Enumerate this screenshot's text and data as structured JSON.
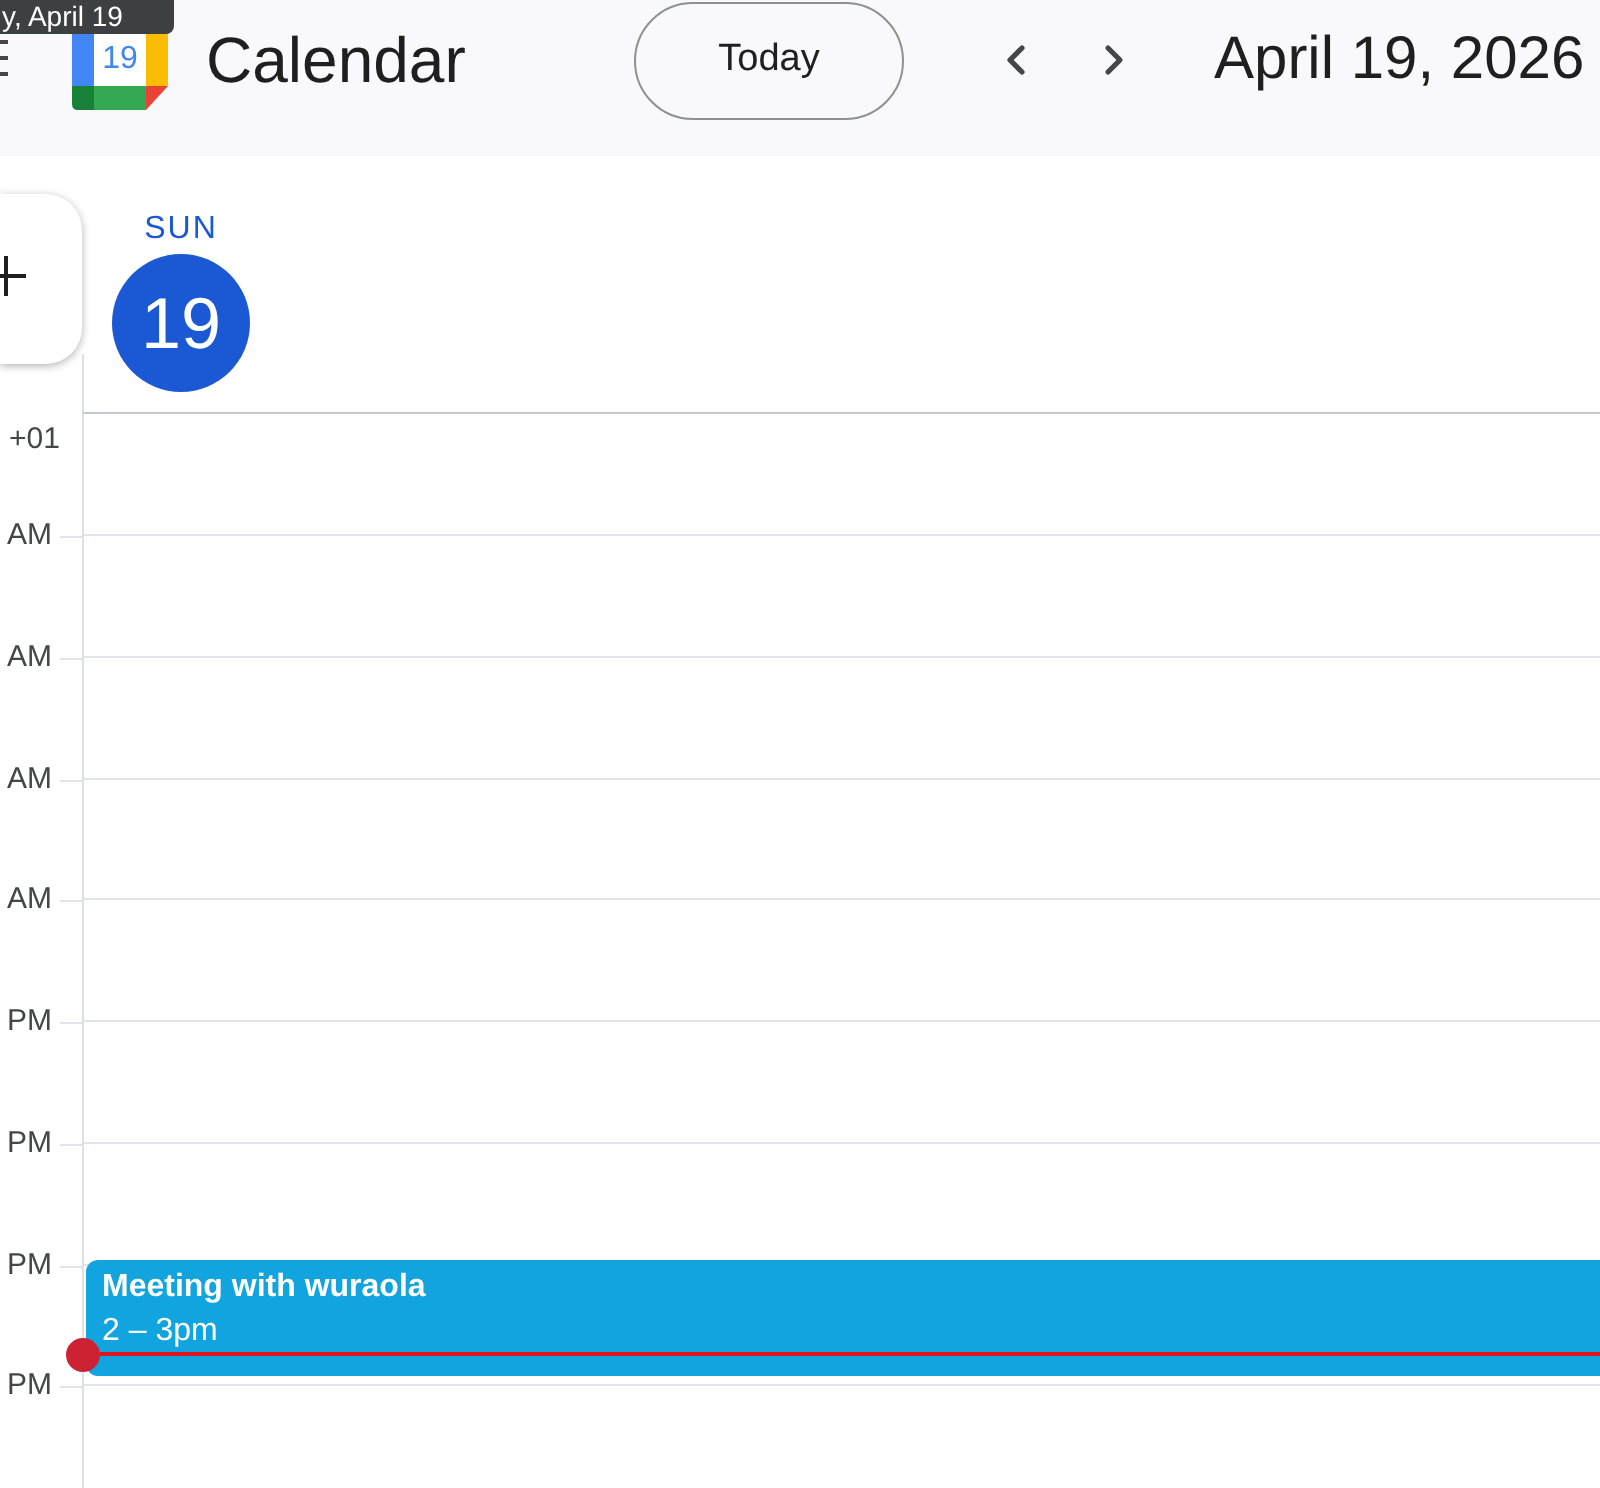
{
  "tooltip": {
    "text": "y, April 19"
  },
  "header": {
    "logo_date": "19",
    "app_name": "Calendar",
    "today_button": "Today",
    "date_title": "April 19, 2026"
  },
  "day": {
    "weekday": "SUN",
    "date": "19",
    "today": true
  },
  "time_labels": [
    "+01",
    "AM",
    "AM",
    "AM",
    "AM",
    "PM",
    "PM",
    "PM",
    "PM"
  ],
  "event": {
    "title": "Meeting with wuraola",
    "time": "2 – 3pm",
    "color": "#12a4df"
  },
  "current_time_shown": true
}
